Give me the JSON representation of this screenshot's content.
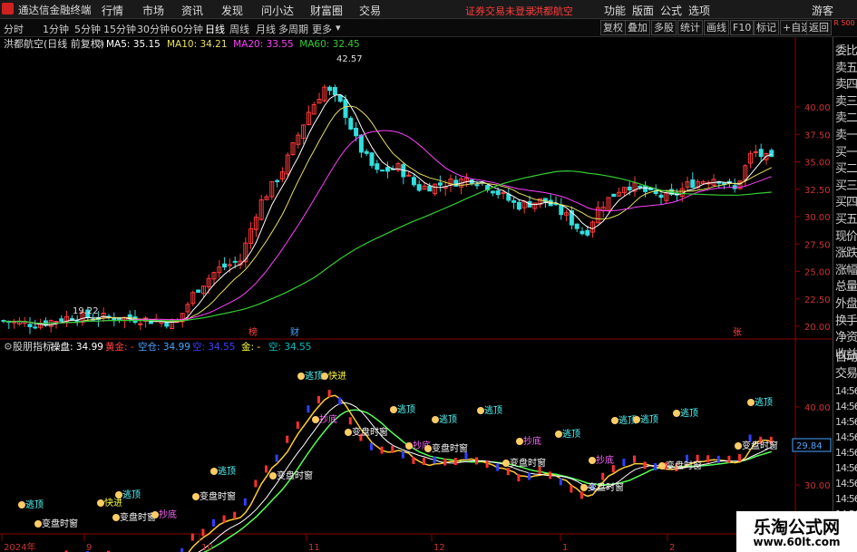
{
  "menu": {
    "app_title": "通达信金融终端",
    "items": [
      "行情",
      "市场",
      "资讯",
      "发现",
      "问小达",
      "财富圈",
      "交易"
    ],
    "notice": "证券交易未登录",
    "stock_name_top": "洪都航空",
    "tools": [
      "功能",
      "版面",
      "公式",
      "选项"
    ],
    "user": "游客"
  },
  "toolbar": {
    "periods": [
      "分时",
      "1分钟",
      "5分钟",
      "15分钟",
      "30分钟",
      "60分钟",
      "日线",
      "周线",
      "月线",
      "多周期",
      "更多"
    ],
    "active_period": "日线",
    "buttons": [
      "复权",
      "叠加",
      "多股",
      "统计",
      "画线",
      "F10",
      "标记",
      "+自选",
      "返回"
    ]
  },
  "main_chart": {
    "title": "洪都航空(日线 前复权)",
    "ma": [
      {
        "label": "MA5: 35.15",
        "color": "#ffffff"
      },
      {
        "label": "MA10: 34.21",
        "color": "#e8e060"
      },
      {
        "label": "MA20: 33.55",
        "color": "#ff40ff"
      },
      {
        "label": "MA60: 32.45",
        "color": "#33cc33"
      }
    ],
    "high_label": "42.57",
    "low_label": "19.22",
    "markers": [
      {
        "text": "榜",
        "color": "#ff4040"
      },
      {
        "text": "财",
        "color": "#4aa3ff"
      },
      {
        "text": "张",
        "color": "#ff4040"
      }
    ],
    "price_ticks": [
      "40.00",
      "37.50",
      "35.00",
      "32.50",
      "30.00",
      "27.50",
      "25.00",
      "22.50",
      "20.00"
    ]
  },
  "indicator": {
    "title": "股朋指标",
    "labels": [
      {
        "text": "操盘: 34.99",
        "color": "#ffffff"
      },
      {
        "text": "黄金: -",
        "color": "#ff4040"
      },
      {
        "text": "空仓: 34.99",
        "color": "#4aa3ff"
      },
      {
        "text": "空: 34.55",
        "color": "#4040ff"
      },
      {
        "text": "金: -",
        "color": "#ffff40"
      },
      {
        "text": "空: 34.55",
        "color": "#00c0c0"
      }
    ],
    "ticks": [
      "40.00",
      "35.00",
      "30.00",
      "25.00"
    ],
    "current_value": "29.84",
    "annotations": {
      "escape": "逃顶",
      "bottom": "抄底",
      "change": "变盘时窗",
      "buy": "快进"
    }
  },
  "xaxis": [
    "2024年",
    "9",
    "10",
    "11",
    "12",
    "1",
    "2"
  ],
  "sidebar": [
    "委比",
    "卖五",
    "卖四",
    "卖三",
    "卖二",
    "卖一",
    "买一",
    "买二",
    "买三",
    "买四",
    "买五",
    "现价",
    "涨跌",
    "涨幅",
    "总量",
    "外盘",
    "换手",
    "净资",
    "收益"
  ],
  "sidebar_bottom": [
    "自动",
    "交易"
  ],
  "sidebar_ticks": [
    "14:56",
    "14:56",
    "14:56",
    "14:56",
    "14:56",
    "14:56",
    "14:56",
    "14:56",
    "14:56"
  ],
  "r_label": "R 500",
  "watermark": {
    "title": "乐淘公式网",
    "url": "www.60lt.com"
  },
  "colors": {
    "up": "#ff3b3b",
    "down": "#33dddd",
    "ma5": "#ffffff",
    "ma10": "#e8e060",
    "ma20": "#ff40ff",
    "ma60": "#33cc33",
    "grid": "#8b0000"
  }
}
